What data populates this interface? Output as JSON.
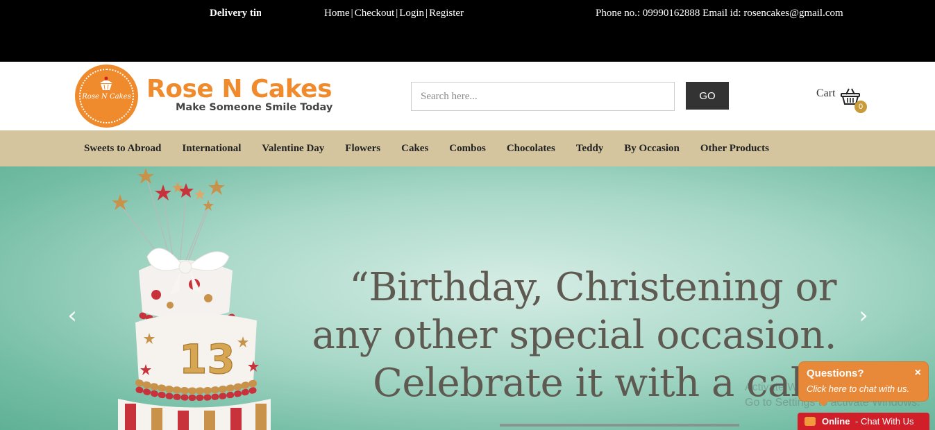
{
  "topbar": {
    "delivery_text": "Delivery time",
    "links": [
      "Home",
      "Checkout",
      "Login",
      "Register"
    ],
    "separator": "|",
    "contact": "Phone no.: 09990162888 Email id: rosencakes@gmail.com"
  },
  "header": {
    "logo_text": "Rose N Cakes",
    "brand_name": "Rose N Cakes",
    "tagline": "Make Someone Smile Today",
    "search_placeholder": "Search here...",
    "go_label": "GO",
    "cart_label": "Cart",
    "cart_count": "0"
  },
  "nav": {
    "items": [
      "Sweets to Abroad",
      "International",
      "Valentine Day",
      "Flowers",
      "Cakes",
      "Combos",
      "Chocolates",
      "Teddy",
      "By Occasion",
      "Other Products"
    ]
  },
  "hero": {
    "quote_lines": [
      "“Birthday, Christening or",
      "any other special occasion.",
      "Celebrate it with a cake"
    ],
    "cake_number": "13",
    "prev_icon": "‹",
    "next_icon": "›",
    "watermark_line1": "Activate Windows",
    "watermark_line2": "Go to Settings to activate Windows."
  },
  "chat": {
    "question": "Questions?",
    "subtitle": "Click here to chat with us.",
    "close": "×",
    "status": "Online",
    "cta": "- Chat With Us"
  },
  "colors": {
    "brand_orange": "#ef8b2c",
    "nav_bg": "#d4c59f",
    "chat_red": "#d11f2a",
    "badge_gold": "#c99b3b"
  }
}
